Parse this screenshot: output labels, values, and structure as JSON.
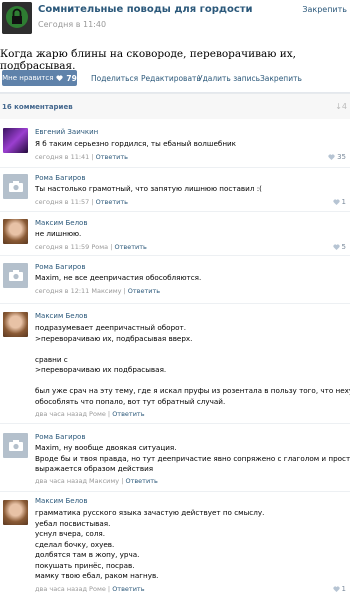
{
  "header": {
    "name": "Сомнительные поводы для гордости",
    "time": "Сегодня в 11:40",
    "pin": "Закрепить"
  },
  "post": {
    "text": "Когда жарю блины на сковороде, переворачиваю их, подбрасывая."
  },
  "actions": {
    "like_label": "Мне нравится",
    "like_count": "79",
    "share": "Поделиться",
    "edit": "Редактировать",
    "delete": "Удалить запись",
    "pin": "Закрепить"
  },
  "comments_header": {
    "count_label": "16 комментариев",
    "collapse": "↓4"
  },
  "comments": [
    {
      "name": "Евгений Заичкин",
      "text": "Я б таким серьезно гордился, ты ебаный волшебник",
      "time": "сегодня в 11:41",
      "reply": "Ответить",
      "likes": "35"
    },
    {
      "name": "Рома Багиров",
      "text": "Ты настолько грамотный, что запятую лишнюю поставил :(",
      "time": "сегодня в 11:57",
      "reply": "Ответить",
      "likes": "1"
    },
    {
      "name": "Максим Белов",
      "text": "не лишнюю.",
      "time": "сегодня в 11:59 Рома",
      "reply": "Ответить",
      "likes": "5"
    },
    {
      "name": "Рома Багиров",
      "text": "Maxim, не все деепричастия обособляются.",
      "time": "сегодня в 12:11 Максиму",
      "reply": "Ответить",
      "likes": ""
    },
    {
      "name": "Максим Белов",
      "text": "подразумевает деепричастный оборот.\n>переворачиваю их, подбрасывая вверх.\n\nсравни с\n>переворачиваю их подбрасывая.\n\nбыл уже срач на эту тему, где я искал пруфы из розентала в пользу того, что нехуй\nобособлять что попало, вот тут обратный случай.",
      "time": "два часа назад Роме",
      "reply": "Ответить",
      "likes": ""
    },
    {
      "name": "Рома Багиров",
      "text": "Maxim, ну вообще двоякая ситуация.\nВроде бы и твоя правда, но тут деепричастие явно сопряжено с глаголом и просто\nвыражается образом действия",
      "time": "два часа назад Максиму",
      "reply": "Ответить",
      "likes": ""
    },
    {
      "name": "Максим Белов",
      "text": "грамматика русского языка зачастую действует по смыслу.\nуебал посвистывая.\nуснул вчера, соля.\nсделал бочку, охуев.\nдолбятся там в жопу, урча.\nпокушать принёс, посрав.\nмамку твою ебал, раком нагнув.",
      "time": "два часа назад Роме",
      "reply": "Ответить",
      "likes": "1"
    }
  ]
}
